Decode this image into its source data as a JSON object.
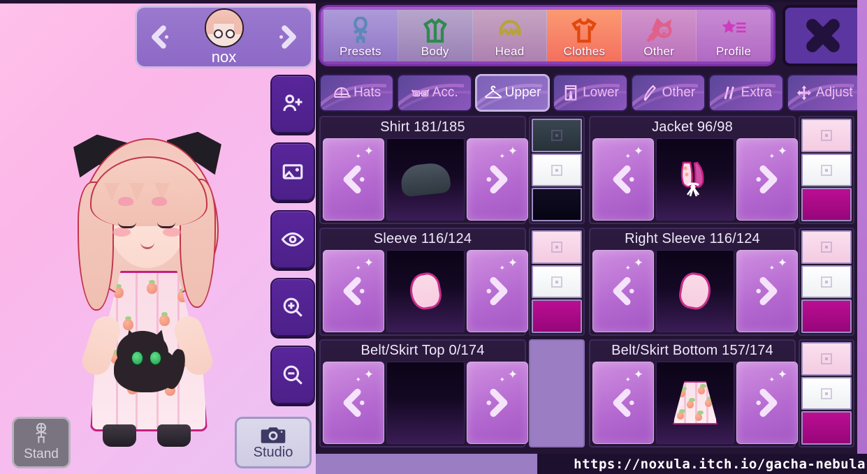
{
  "watermark": "https://noxula.itch.io/gacha-nebula",
  "character_panel": {
    "name": "nox",
    "prev_label": "<",
    "next_label": ">",
    "avatar_name": "nox-avatar"
  },
  "stage_tools": [
    {
      "name": "add-character",
      "icon": "person-plus-icon"
    },
    {
      "name": "background",
      "icon": "image-icon"
    },
    {
      "name": "preview-visibility",
      "icon": "eye-icon"
    },
    {
      "name": "zoom-in",
      "icon": "magnifier-plus-icon"
    },
    {
      "name": "zoom-out",
      "icon": "magnifier-minus-icon"
    }
  ],
  "stand_button": {
    "label": "Stand",
    "icon": "mannequin-icon"
  },
  "studio_button": {
    "label": "Studio",
    "icon": "camera-icon"
  },
  "close_button": {
    "label": "X",
    "icon": "close-icon"
  },
  "main_tabs": [
    {
      "label": "Presets",
      "icon": "body-outline-icon",
      "active": false,
      "accent": "#8fb8dd"
    },
    {
      "label": "Body",
      "icon": "jacket-icon",
      "active": false,
      "accent": "#67c489"
    },
    {
      "label": "Head",
      "icon": "hair-icon",
      "active": false,
      "accent": "#ded79a"
    },
    {
      "label": "Clothes",
      "icon": "tshirt-icon",
      "active": true,
      "accent": "#f2762f"
    },
    {
      "label": "Other",
      "icon": "sword-cat-icon",
      "active": false,
      "accent": "#f28ab0"
    },
    {
      "label": "Profile",
      "icon": "star-list-icon",
      "active": false,
      "accent": "#d84fc6"
    }
  ],
  "sub_tabs": [
    {
      "label": "Hats",
      "icon": "cap-icon",
      "active": false
    },
    {
      "label": "Acc.",
      "icon": "glasses-icon",
      "active": false
    },
    {
      "label": "Upper",
      "icon": "hanger-icon",
      "active": true
    },
    {
      "label": "Lower",
      "icon": "pants-icon",
      "active": false
    },
    {
      "label": "Other",
      "icon": "cape-icon",
      "active": false
    },
    {
      "label": "Extra",
      "icon": "slashes-icon",
      "active": false
    },
    {
      "label": "Adjust",
      "icon": "move-arrows-icon",
      "active": false
    }
  ],
  "items": [
    {
      "title": "Shirt 181/185",
      "art": "shirt",
      "empty": false,
      "swatches": [
        "#2f3b45",
        "#fbfbfb",
        "#0c0a1c"
      ],
      "swatch_empty": false,
      "prev_label": "<",
      "next_label": ">"
    },
    {
      "title": "Jacket 96/98",
      "art": "jacket",
      "empty": false,
      "swatches": [
        "#f8d6e8",
        "#fbfbfb",
        "#ab0e86"
      ],
      "swatch_empty": false,
      "prev_label": "<",
      "next_label": ">"
    },
    {
      "title": "Sleeve 116/124",
      "art": "sleeve",
      "empty": false,
      "swatches": [
        "#f8d6e8",
        "#fbfbfb",
        "#ab0e86"
      ],
      "swatch_empty": false,
      "prev_label": "<",
      "next_label": ">"
    },
    {
      "title": "Right Sleeve 116/124",
      "art": "sleeve",
      "empty": false,
      "swatches": [
        "#f8d6e8",
        "#fbfbfb",
        "#ab0e86"
      ],
      "swatch_empty": false,
      "prev_label": "<",
      "next_label": ">"
    },
    {
      "title": "Belt/Skirt Top 0/174",
      "art": "none",
      "empty": true,
      "swatches": [],
      "swatch_empty": true,
      "prev_label": "<",
      "next_label": ">"
    },
    {
      "title": "Belt/Skirt Bottom 157/174",
      "art": "skirt",
      "empty": false,
      "swatches": [
        "#f8d6e8",
        "#fbfbfb",
        "#ab0e86"
      ],
      "swatch_empty": false,
      "prev_label": "<",
      "next_label": ">"
    }
  ],
  "colors": {
    "panel_bg": "#231434",
    "panel_border": "#1d0f2e",
    "accent_purple": "#8a3fb5",
    "arrow_button": "#b367cf",
    "active_tab": "#f2762f"
  }
}
